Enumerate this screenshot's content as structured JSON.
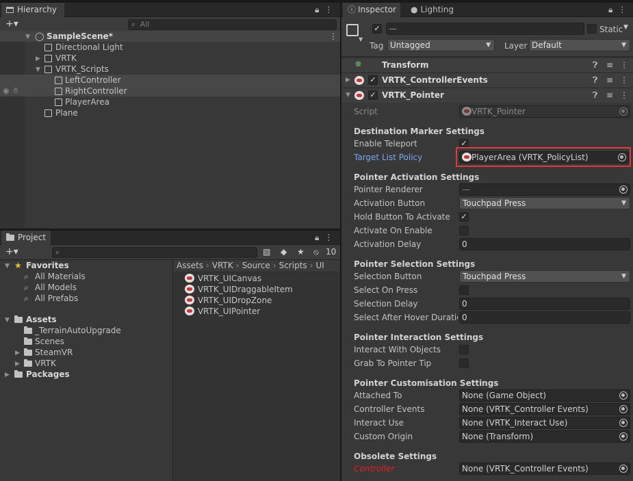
{
  "hierarchy": {
    "tab": "Hierarchy",
    "add_label": "+▾",
    "search_placeholder": "All",
    "scene": "SampleScene*",
    "items": [
      "Directional Light",
      "VRTK",
      "VRTK_Scripts",
      "LeftController",
      "RightController",
      "PlayerArea",
      "Plane"
    ]
  },
  "project": {
    "tab": "Project",
    "add_label": "+▾",
    "count": "10",
    "favorites_label": "Favorites",
    "favorites": [
      "All Materials",
      "All Models",
      "All Prefabs"
    ],
    "assets_label": "Assets",
    "assets": [
      "_TerrainAutoUpgrade",
      "Scenes",
      "SteamVR",
      "VRTK"
    ],
    "packages_label": "Packages",
    "breadcrumb": [
      "Assets",
      "VRTK",
      "Source",
      "Scripts",
      "UI"
    ],
    "files": [
      "VRTK_UICanvas",
      "VRTK_UIDraggableItem",
      "VRTK_UIDropZone",
      "VRTK_UIPointer"
    ]
  },
  "inspector": {
    "tab": "Inspector",
    "lighting_tab": "Lighting",
    "name_value": "—",
    "static_label": "Static",
    "tag_label": "Tag",
    "tag_value": "Untagged",
    "layer_label": "Layer",
    "layer_value": "Default",
    "components": [
      "Transform",
      "VRTK_ControllerEvents",
      "VRTK_Pointer"
    ],
    "script_label": "Script",
    "script_value": "VRTK_Pointer",
    "sections": {
      "destination": "Destination Marker Settings",
      "activation": "Pointer Activation Settings",
      "selection": "Pointer Selection Settings",
      "interaction": "Pointer Interaction Settings",
      "customisation": "Pointer Customisation Settings",
      "obsolete": "Obsolete Settings"
    },
    "fields": {
      "enable_teleport": "Enable Teleport",
      "target_list_policy": "Target List Policy",
      "target_list_policy_value": "PlayerArea (VRTK_PolicyList)",
      "pointer_renderer": "Pointer Renderer",
      "pointer_renderer_value": "—",
      "activation_button": "Activation Button",
      "activation_button_value": "Touchpad Press",
      "hold_button": "Hold Button To Activate",
      "activate_on_enable": "Activate On Enable",
      "activation_delay": "Activation Delay",
      "activation_delay_value": "0",
      "selection_button": "Selection Button",
      "selection_button_value": "Touchpad Press",
      "select_on_press": "Select On Press",
      "selection_delay": "Selection Delay",
      "selection_delay_value": "0",
      "select_after_hover": "Select After Hover Duration",
      "select_after_hover_value": "0",
      "interact_with_objects": "Interact With Objects",
      "grab_to_pointer_tip": "Grab To Pointer Tip",
      "attached_to": "Attached To",
      "attached_to_value": "None (Game Object)",
      "controller_events": "Controller Events",
      "controller_events_value": "None (VRTK_Controller Events)",
      "interact_use": "Interact Use",
      "interact_use_value": "None (VRTK_Interact Use)",
      "custom_origin": "Custom Origin",
      "custom_origin_value": "None (Transform)",
      "controller": "Controller",
      "controller_value": "None (VRTK_Controller Events)"
    }
  },
  "colors": {
    "highlight_box": "#e03a3a",
    "link_label": "#7aa7ef",
    "obsolete_label": "#e02020"
  }
}
